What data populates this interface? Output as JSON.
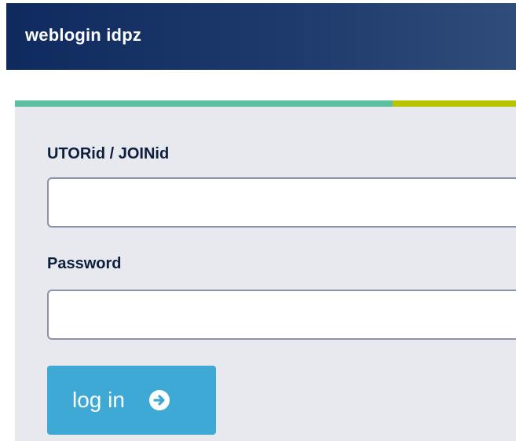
{
  "header": {
    "title": "weblogin idpz"
  },
  "login_form": {
    "username_label": "UTORid / JOINid",
    "username_value": "",
    "password_label": "Password",
    "password_value": "",
    "submit_label": "log in",
    "submit_icon": "arrow-circle-right-icon"
  },
  "colors": {
    "header_dark": "#0f2a5e",
    "accent_green": "#5bbfa0",
    "accent_yellow": "#b8c400",
    "button_blue": "#3fa9d6",
    "card_background": "#e7e9ee"
  }
}
